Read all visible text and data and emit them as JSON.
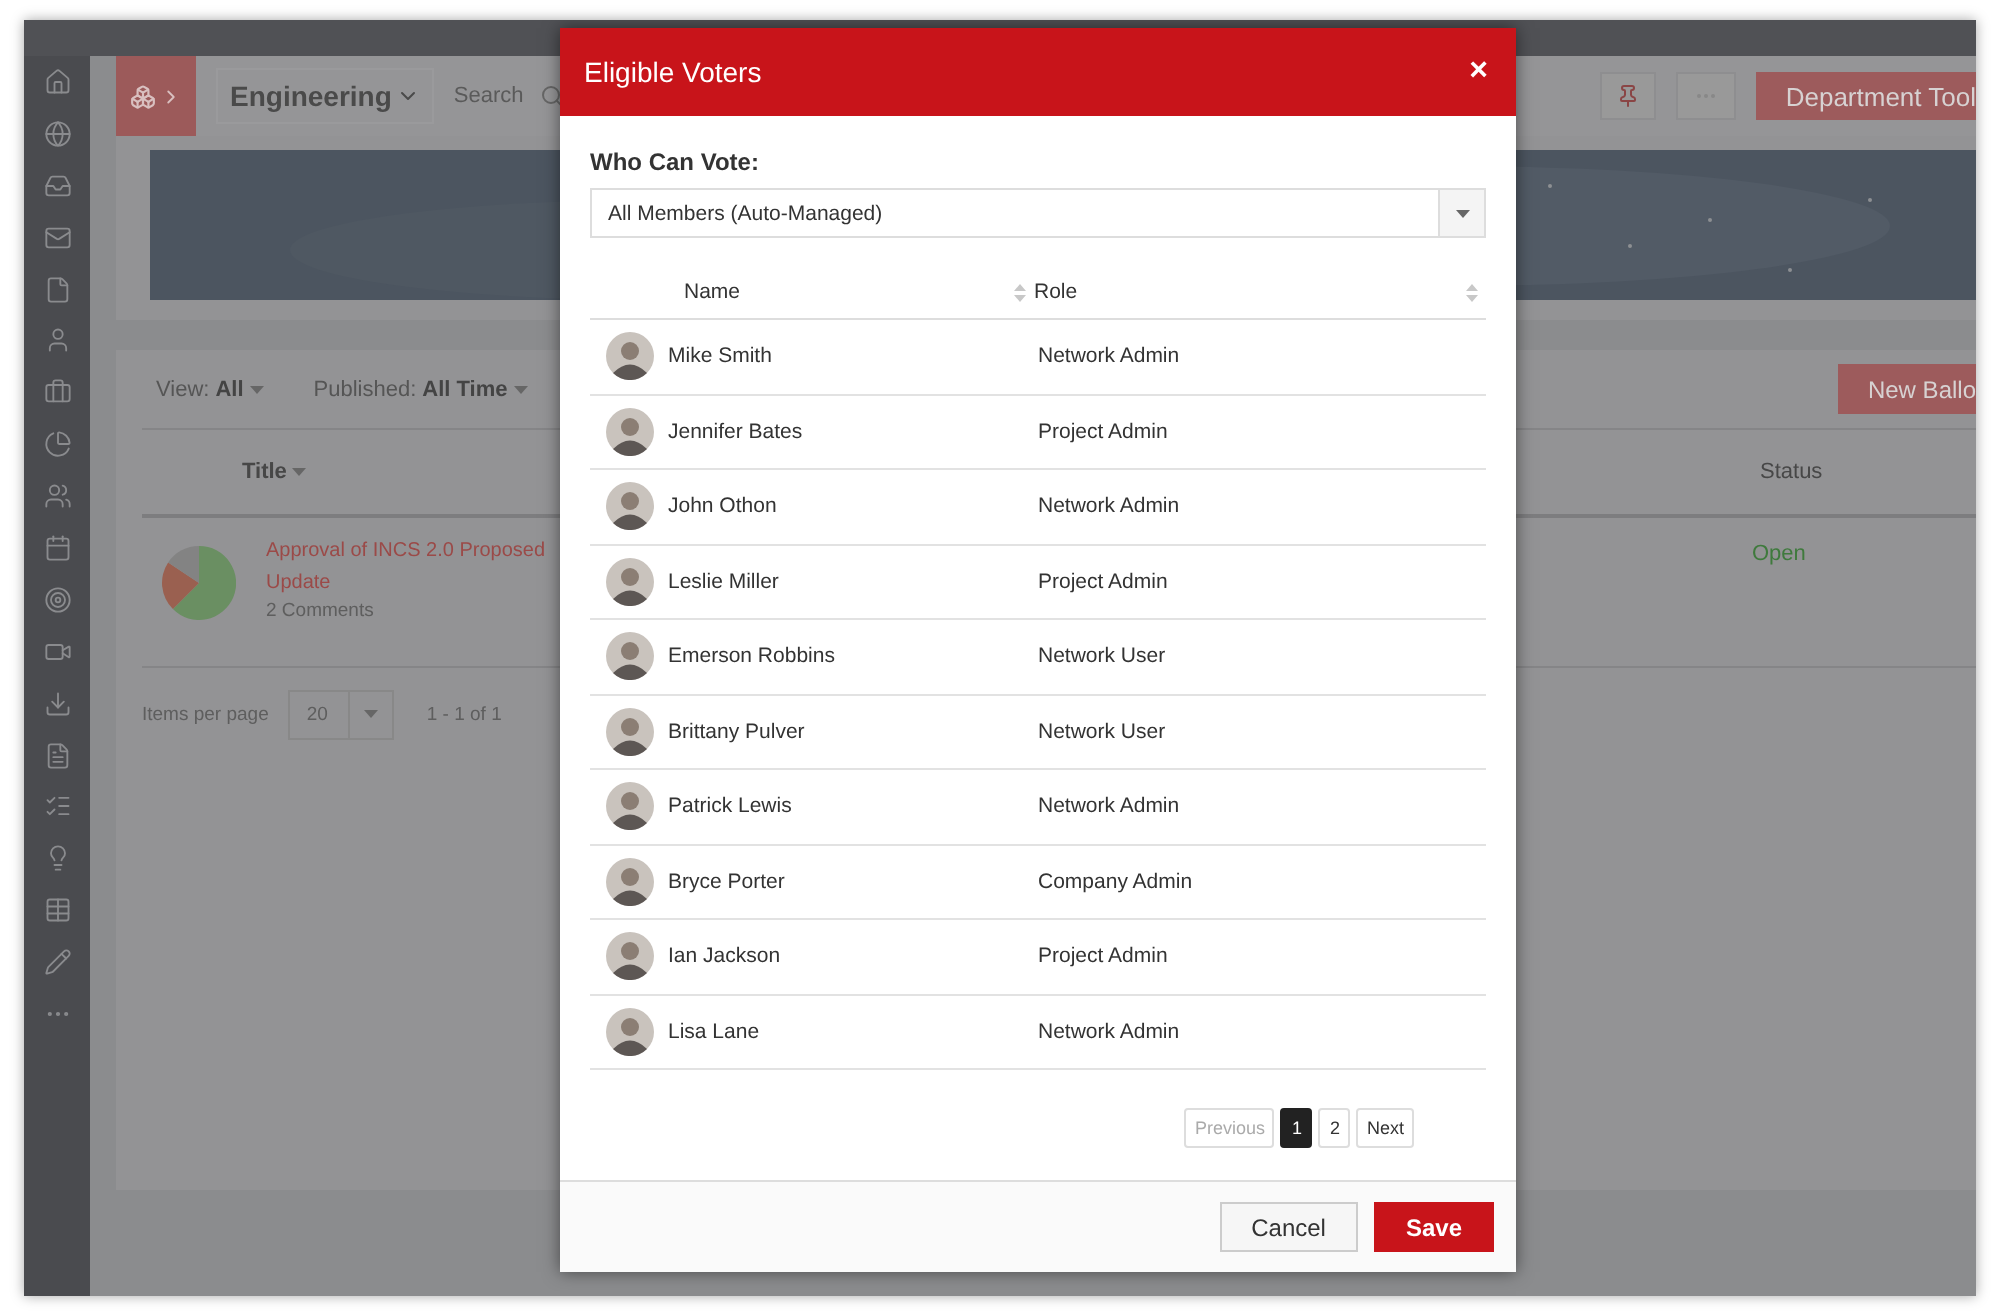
{
  "header": {
    "workspace": "Engineering",
    "search_placeholder": "Search",
    "action_button": "Department Tool"
  },
  "filters": [
    {
      "label": "View:",
      "value": "All"
    },
    {
      "label": "Published:",
      "value": "All Time"
    }
  ],
  "new_button": "New Ballo",
  "table": {
    "columns": [
      "Title",
      "Status"
    ],
    "rows": [
      {
        "title": "Approval of INCS 2.0 Proposed Update",
        "comments": "2 Comments",
        "status": "Open"
      }
    ]
  },
  "pagination": {
    "label": "Items per page",
    "page_size": "20",
    "range": "1 - 1 of 1"
  },
  "modal": {
    "title": "Eligible Voters",
    "close": "×",
    "field_label": "Who Can Vote:",
    "field_value": "All Members (Auto-Managed)",
    "columns": [
      "Name",
      "Role"
    ],
    "rows": [
      {
        "name": "Mike Smith",
        "role": "Network Admin"
      },
      {
        "name": "Jennifer Bates",
        "role": "Project Admin"
      },
      {
        "name": "John Othon",
        "role": "Network Admin"
      },
      {
        "name": "Leslie Miller",
        "role": "Project Admin"
      },
      {
        "name": "Emerson Robbins",
        "role": "Network User"
      },
      {
        "name": "Brittany Pulver",
        "role": "Network User"
      },
      {
        "name": "Patrick Lewis",
        "role": "Network Admin"
      },
      {
        "name": "Bryce Porter",
        "role": "Company Admin"
      },
      {
        "name": "Ian Jackson",
        "role": "Project Admin"
      },
      {
        "name": "Lisa Lane",
        "role": "Network Admin"
      }
    ],
    "pager": {
      "previous": {
        "label": "Previous",
        "disabled": true
      },
      "pages": [
        {
          "label": "1",
          "selected": true
        },
        {
          "label": "2",
          "selected": false
        }
      ],
      "next": {
        "label": "Next",
        "disabled": false
      }
    },
    "buttons": [
      {
        "label": "Cancel",
        "kind": "secondary"
      },
      {
        "label": "Save",
        "kind": "primary"
      }
    ]
  }
}
